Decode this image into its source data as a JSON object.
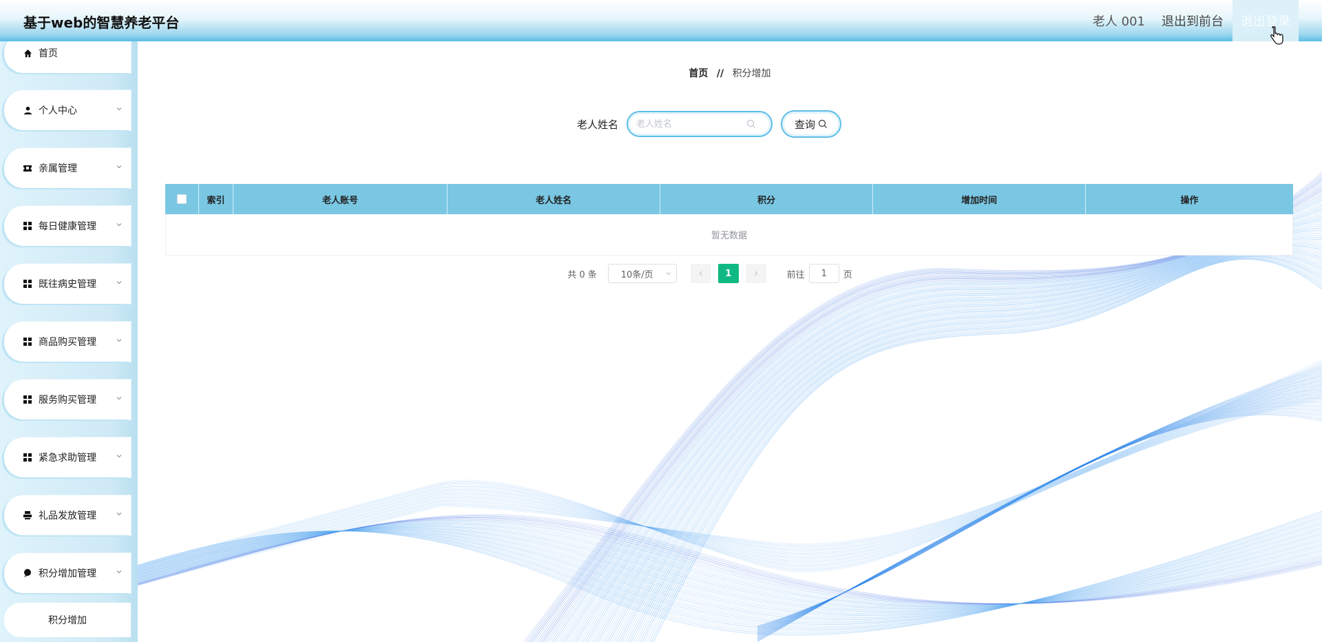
{
  "header": {
    "title": "基于web的智慧养老平台",
    "user": "老人 001",
    "to_front": "退出到前台",
    "logout": "退出登录"
  },
  "sidebar": {
    "items": [
      {
        "label": "首页",
        "icon": "home-icon"
      },
      {
        "label": "个人中心",
        "icon": "user-icon"
      },
      {
        "label": "亲属管理",
        "icon": "ticket-icon"
      },
      {
        "label": "每日健康管理",
        "icon": "grid-icon"
      },
      {
        "label": "既往病史管理",
        "icon": "grid-icon"
      },
      {
        "label": "商品购买管理",
        "icon": "grid-icon"
      },
      {
        "label": "服务购买管理",
        "icon": "grid-icon"
      },
      {
        "label": "紧急求助管理",
        "icon": "grid-icon"
      },
      {
        "label": "礼品发放管理",
        "icon": "printer-icon"
      },
      {
        "label": "积分增加管理",
        "icon": "pin-icon"
      }
    ],
    "sub_item": "积分增加"
  },
  "breadcrumb": {
    "home": "首页",
    "separator": "//",
    "current": "积分增加"
  },
  "search": {
    "label": "老人姓名",
    "placeholder": "老人姓名",
    "value": "",
    "button": "查询"
  },
  "table": {
    "columns": [
      "索引",
      "老人账号",
      "老人姓名",
      "积分",
      "增加时间",
      "操作"
    ],
    "rows": [],
    "empty_text": "暂无数据"
  },
  "pagination": {
    "total": "共 0 条",
    "page_size": "10条/页",
    "current_page": "1",
    "goto_label": "前往",
    "goto_value": "1",
    "page_suffix": "页"
  },
  "colors": {
    "accent": "#7ac7e3",
    "active_page": "#10b981",
    "wave": "#1e88e5"
  }
}
